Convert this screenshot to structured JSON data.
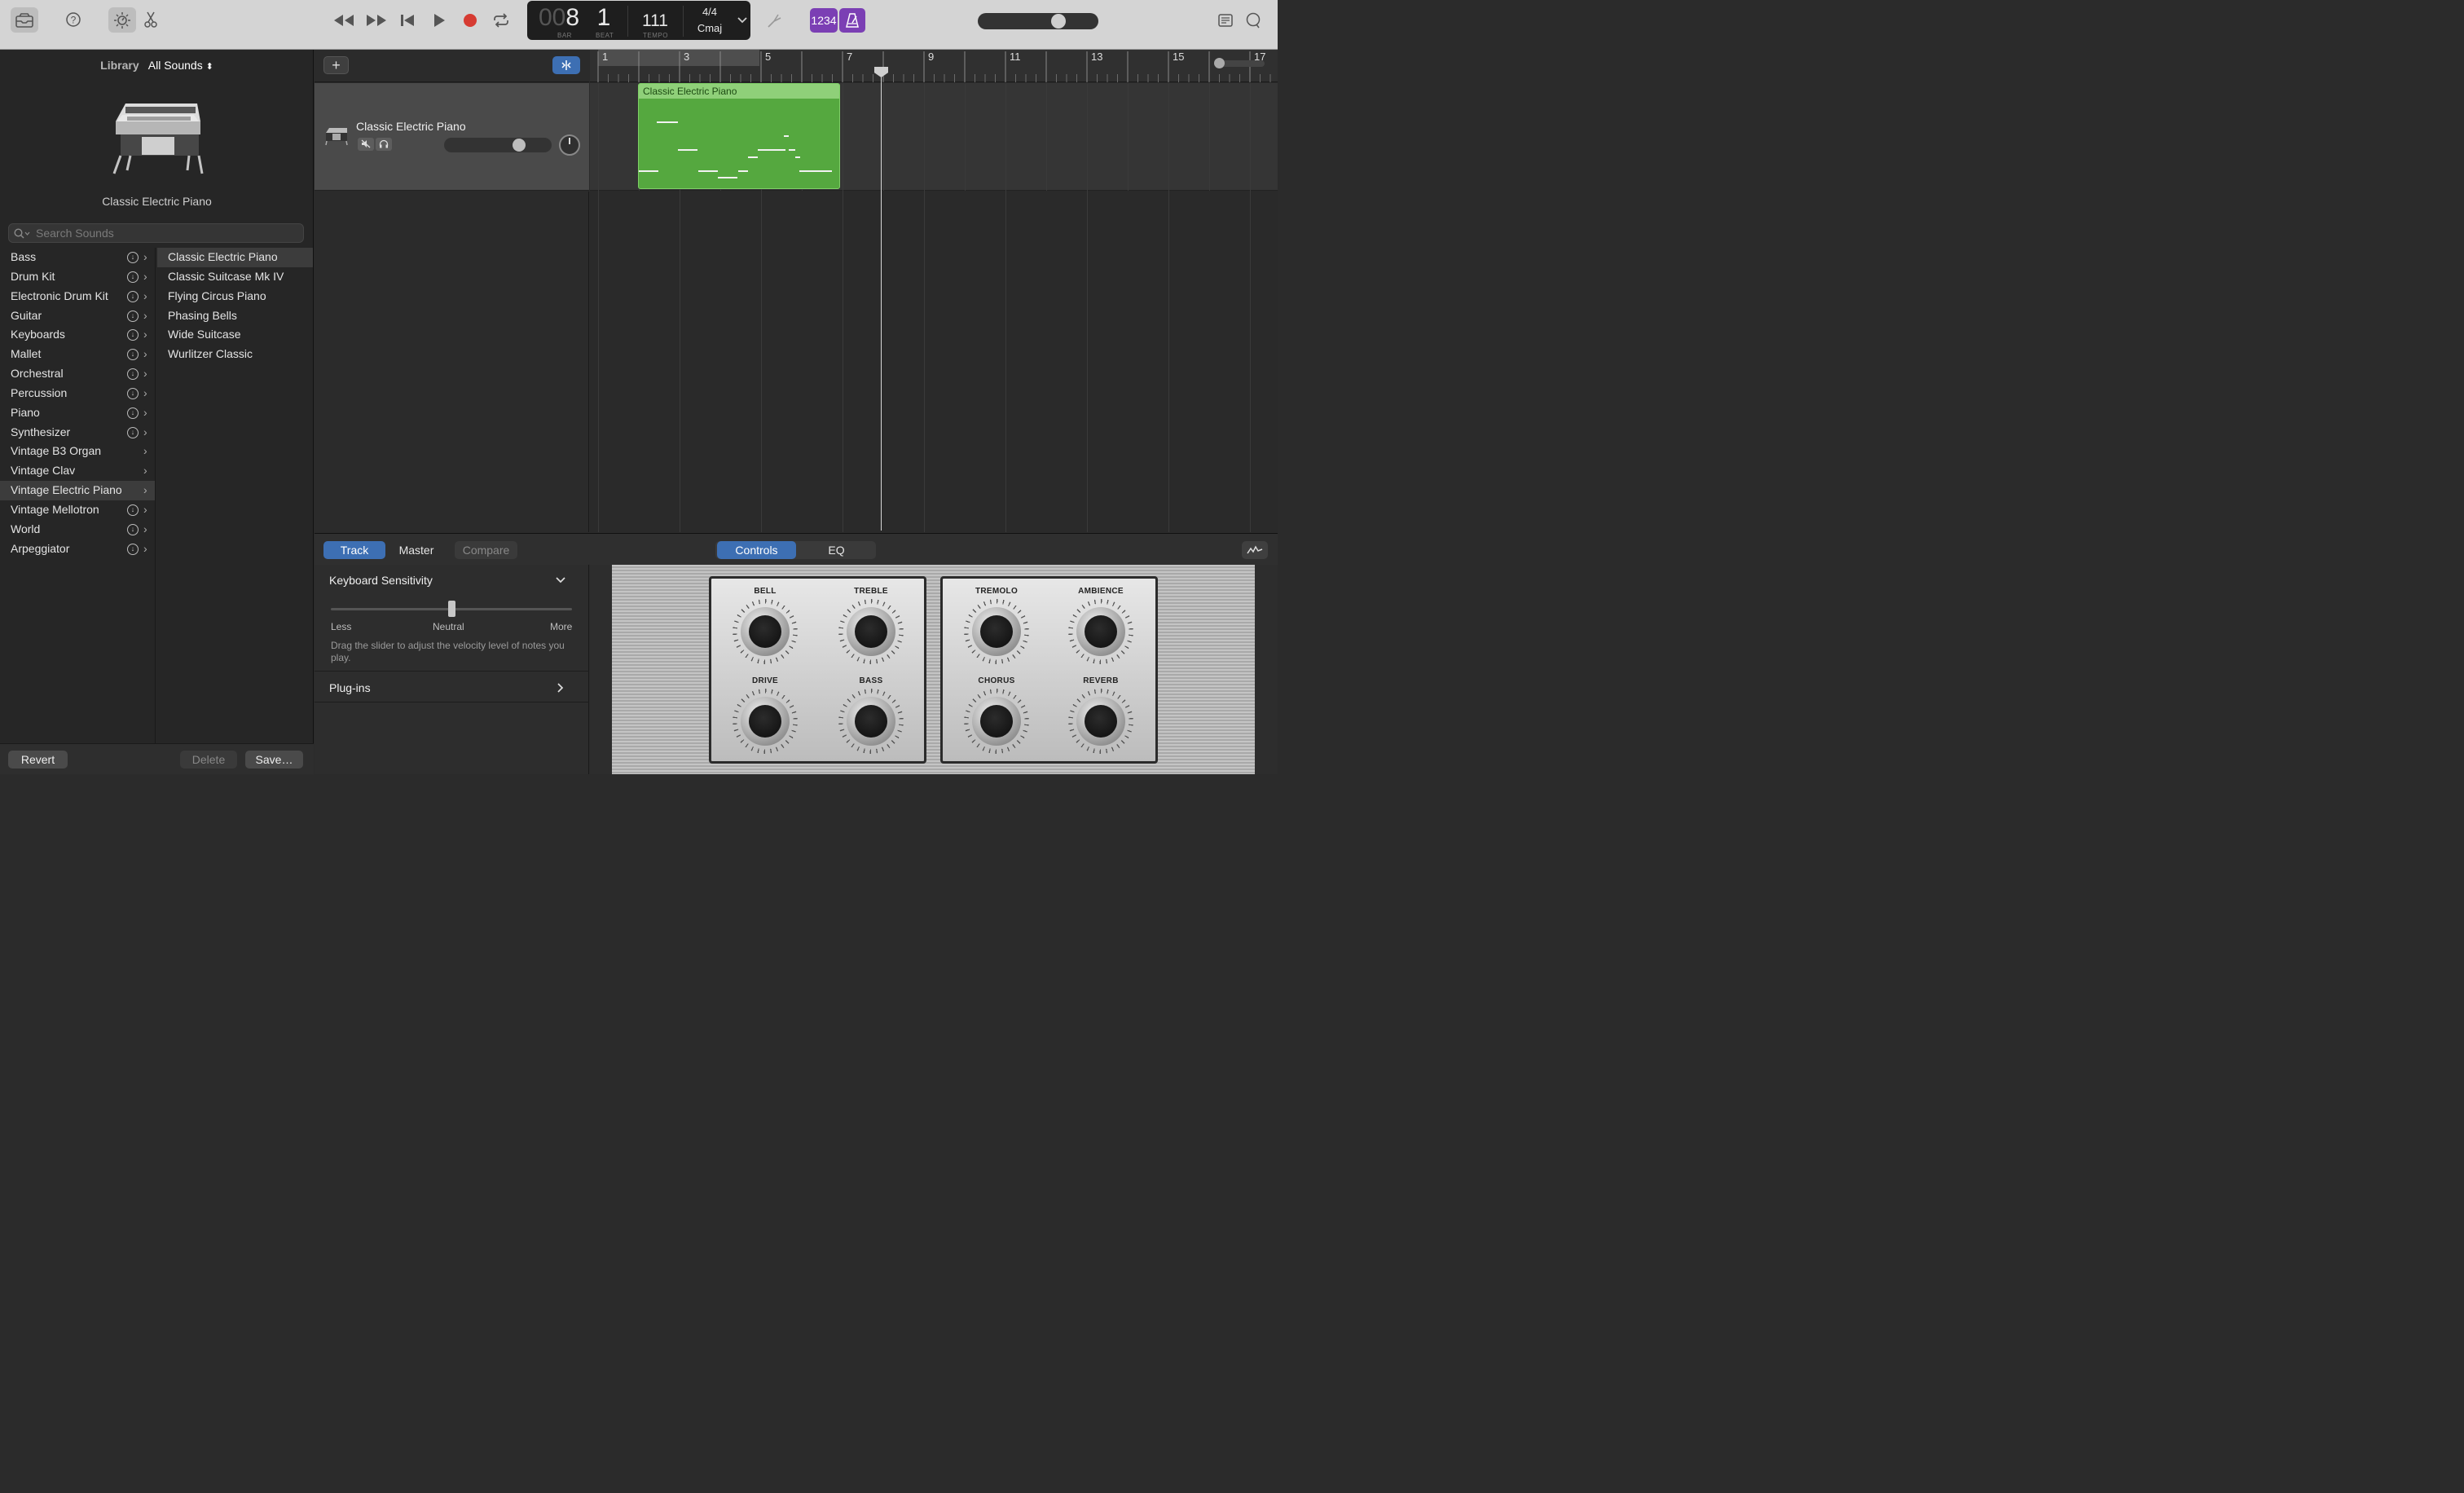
{
  "toolbar": {
    "lcd": {
      "bar_dim": "00",
      "bar": "8",
      "beat": "1",
      "bar_label": "BAR",
      "beat_label": "BEAT",
      "tempo": "111",
      "tempo_label": "TEMPO",
      "time_sig": "4/4",
      "key": "Cmaj"
    },
    "count_in_label": "1234",
    "master_volume": 0.7,
    "accent_color": "#7b3fb4"
  },
  "library": {
    "label": "Library",
    "filter": "All Sounds",
    "preset_name": "Classic Electric Piano",
    "search_placeholder": "Search Sounds",
    "categories": [
      {
        "label": "Bass",
        "download": true
      },
      {
        "label": "Drum Kit",
        "download": true
      },
      {
        "label": "Electronic Drum Kit",
        "download": true
      },
      {
        "label": "Guitar",
        "download": true
      },
      {
        "label": "Keyboards",
        "download": true
      },
      {
        "label": "Mallet",
        "download": true
      },
      {
        "label": "Orchestral",
        "download": true
      },
      {
        "label": "Percussion",
        "download": true
      },
      {
        "label": "Piano",
        "download": true
      },
      {
        "label": "Synthesizer",
        "download": true
      },
      {
        "label": "Vintage B3 Organ",
        "download": false
      },
      {
        "label": "Vintage Clav",
        "download": false
      },
      {
        "label": "Vintage Electric Piano",
        "download": false,
        "selected": true
      },
      {
        "label": "Vintage Mellotron",
        "download": true
      },
      {
        "label": "World",
        "download": true
      },
      {
        "label": "Arpeggiator",
        "download": true
      }
    ],
    "patches": [
      {
        "label": "Classic Electric Piano",
        "selected": true
      },
      {
        "label": "Classic Suitcase Mk IV"
      },
      {
        "label": "Flying Circus Piano"
      },
      {
        "label": "Phasing Bells"
      },
      {
        "label": "Wide Suitcase"
      },
      {
        "label": "Wurlitzer Classic"
      }
    ],
    "footer": {
      "revert": "Revert",
      "delete": "Delete",
      "save": "Save…"
    }
  },
  "tracks": {
    "add_label": "+",
    "track_name": "Classic Electric Piano",
    "track_volume": 0.7,
    "region_name": "Classic Electric Piano",
    "ruler_bars": [
      "1",
      "3",
      "5",
      "7",
      "9",
      "11",
      "13",
      "15",
      "17"
    ],
    "playhead_bar": 8.1
  },
  "editor": {
    "tabs": {
      "track": "Track",
      "master": "Master",
      "compare": "Compare"
    },
    "view_tabs": {
      "controls": "Controls",
      "eq": "EQ"
    },
    "keyboard_sensitivity": {
      "title": "Keyboard Sensitivity",
      "less": "Less",
      "neutral": "Neutral",
      "more": "More",
      "description": "Drag the slider to adjust the velocity level of notes you play.",
      "value": 0.5
    },
    "plugins_label": "Plug-ins",
    "knobs": {
      "bell": "BELL",
      "treble": "TREBLE",
      "drive": "DRIVE",
      "bass": "BASS",
      "tremolo": "TREMOLO",
      "ambience": "AMBIENCE",
      "chorus": "CHORUS",
      "reverb": "REVERB"
    }
  }
}
